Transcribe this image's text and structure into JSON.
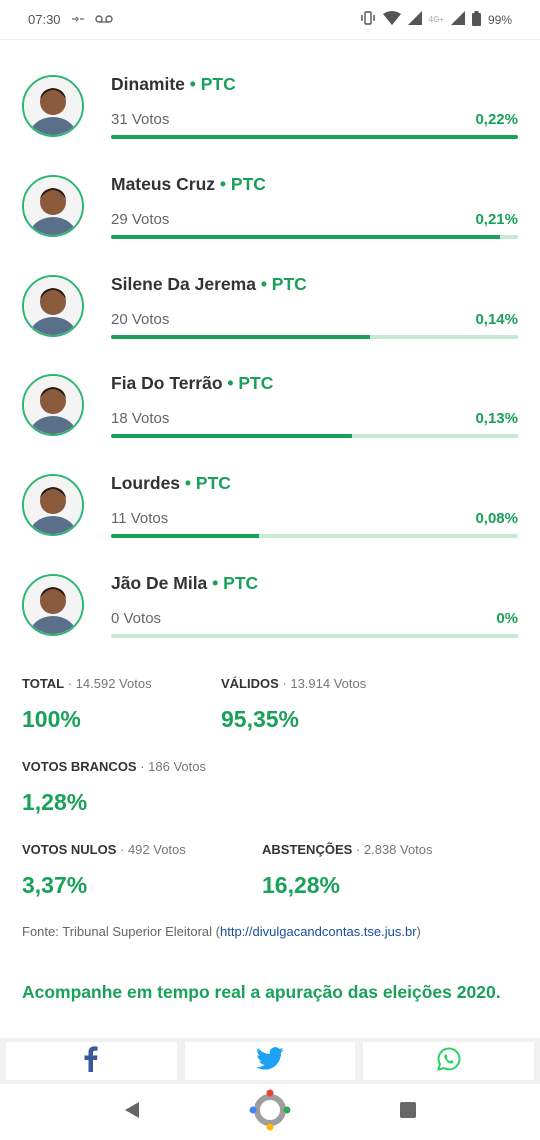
{
  "status_bar": {
    "time": "07:30",
    "network": "4G+",
    "battery": "99%"
  },
  "candidates": [
    {
      "name": "Dinamite",
      "party": " • PTC",
      "votes": "31 Votos",
      "percent": "0,22%",
      "share": 0.22
    },
    {
      "name": "Mateus Cruz",
      "party": " • PTC",
      "votes": "29 Votos",
      "percent": "0,21%",
      "share": 0.21
    },
    {
      "name": "Silene Da Jerema",
      "party": " • PTC",
      "votes": "20 Votos",
      "percent": "0,14%",
      "share": 0.14
    },
    {
      "name": "Fia Do Terrão",
      "party": " • PTC",
      "votes": "18 Votos",
      "percent": "0,13%",
      "share": 0.13
    },
    {
      "name": "Lourdes",
      "party": " • PTC",
      "votes": "11 Votos",
      "percent": "0,08%",
      "share": 0.08
    },
    {
      "name": "Jão De Mila",
      "party": " • PTC",
      "votes": "0 Votos",
      "percent": "0%",
      "share": 0
    }
  ],
  "stats": {
    "total": {
      "label": "TOTAL",
      "votes": " · 14.592 Votos",
      "value": "100%"
    },
    "validos": {
      "label": "VÁLIDOS",
      "votes": " · 13.914 Votos",
      "value": "95,35%"
    },
    "brancos": {
      "label": "VOTOS BRANCOS",
      "votes": " · 186 Votos",
      "value": "1,28%"
    },
    "nulos": {
      "label": "VOTOS NULOS",
      "votes": " · 492 Votos",
      "value": "3,37%"
    },
    "abstencoes": {
      "label": "ABSTENÇÕES",
      "votes": " · 2.838 Votos",
      "value": "16,28%"
    }
  },
  "source": {
    "prefix": "Fonte: Tribunal Superior Eleitoral (",
    "link": "http://divulgacandcontas.tse.jus.br",
    "suffix": ")"
  },
  "live_link": "Acompanhe em tempo real a apuração das eleições 2020.",
  "share": {
    "facebook_icon": "facebook-icon",
    "twitter_icon": "twitter-icon",
    "whatsapp_icon": "whatsapp-icon"
  },
  "colors": {
    "accent": "#19a15a",
    "bar_track": "#c6e9d4",
    "link": "#1a4fa0",
    "facebook": "#3b5998",
    "twitter": "#1da1f2",
    "whatsapp": "#25d366"
  }
}
